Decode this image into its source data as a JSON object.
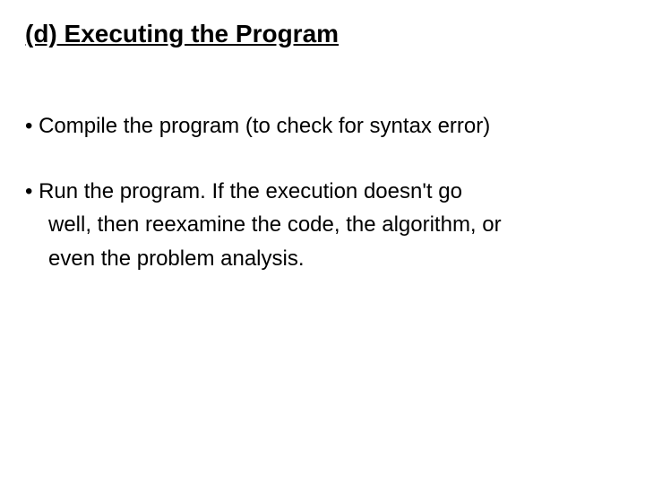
{
  "heading": "(d) Executing the Program",
  "bullets": [
    {
      "line1": "• Compile the program (to check for syntax error)"
    },
    {
      "line1": "• Run the program. If the execution doesn't go",
      "line2": "well, then reexamine the code, the algorithm, or",
      "line3": "even the problem analysis."
    }
  ]
}
